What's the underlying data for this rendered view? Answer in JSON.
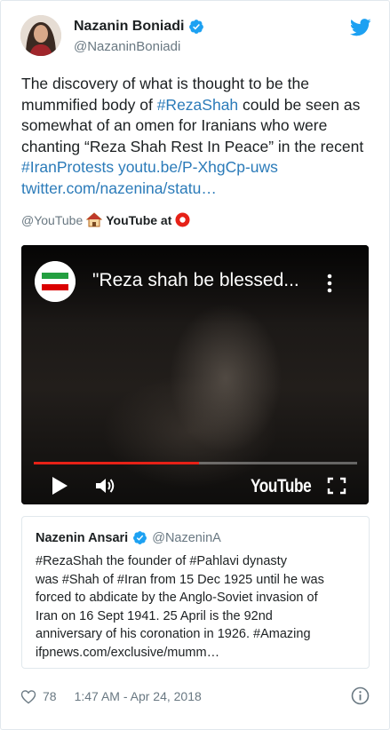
{
  "colors": {
    "link": "#2b7bb9",
    "secondary_text": "#697882",
    "verified": "#1da1f2",
    "twitter_blue": "#1da1f2",
    "progress": "#e62117"
  },
  "author": {
    "name": "Nazanin Boniadi",
    "handle": "@NazaninBoniadi",
    "verified_icon": "verified-badge-icon",
    "avatar_icon": "avatar"
  },
  "logo_icon": "twitter-bird-icon",
  "tweet": {
    "line1": "The discovery of what is thought to be the",
    "line2_pre": "mummified body of ",
    "line2_link": "#RezaShah",
    "line2_post": " could be seen as",
    "line3": "somewhat of an omen for Iranians who were",
    "line4": "chanting “Reza Shah Rest In Peace” in the recent",
    "line5_link1": "#IranProtests",
    "line5_link2": "youtu.be/P-XhgCp-uws",
    "line6_link": "twitter.com/nazenina/statu…"
  },
  "source": {
    "handle": "@YouTube",
    "house_icon": "house-icon",
    "label": "YouTube at",
    "yt_icon": "youtube-record-icon"
  },
  "video": {
    "title": "\"Reza shah be blessed...",
    "brand": "YouTube",
    "progress_fraction": 0.51,
    "channel_icon": "iran-flag-icon",
    "menu_icon": "more-vertical-icon",
    "play_icon": "play-icon",
    "volume_icon": "volume-icon",
    "fullscreen_icon": "fullscreen-icon"
  },
  "quote": {
    "name": "Nazenin Ansari",
    "handle": "@NazeninA",
    "lines": [
      "#RezaShah the founder of #Pahlavi dynasty",
      "was #Shah of #Iran from 15 Dec 1925 until he was",
      "forced to abdicate by the Anglo-Soviet invasion of",
      "Iran on 16 Sept 1941.  25 April is the 92nd",
      "anniversary of his coronation in 1926. #Amazing",
      "ifpnews.com/exclusive/mumm…"
    ]
  },
  "footer": {
    "likes": "78",
    "timestamp": "1:47 AM - Apr 24, 2018",
    "heart_icon": "heart-icon",
    "info_icon": "info-icon"
  }
}
